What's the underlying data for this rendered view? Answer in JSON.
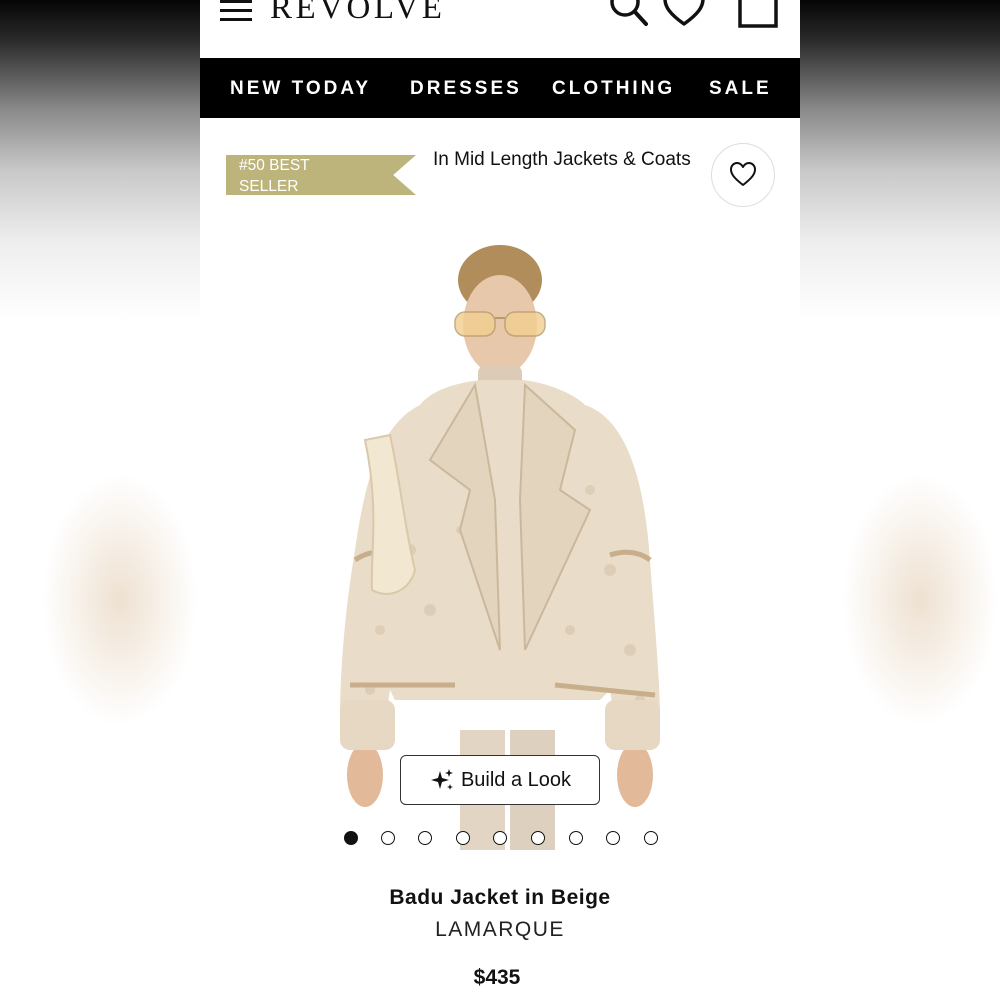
{
  "header": {
    "logo": "REVOLVE",
    "icons": [
      "menu-icon",
      "search-icon",
      "heart-icon",
      "shopping-bag-icon"
    ]
  },
  "nav": {
    "items": [
      "NEW TODAY",
      "DRESSES",
      "CLOTHING",
      "SALE"
    ]
  },
  "badge": {
    "label": "#50 BEST SELLER",
    "color": "#bdb47c"
  },
  "category": {
    "text": "In Mid Length Jackets & Coats"
  },
  "gallery": {
    "build_look_label": "Build a Look",
    "image_count": 9,
    "current_image": 1
  },
  "product": {
    "name": "Badu Jacket in Beige",
    "brand": "LAMARQUE",
    "price": "$435"
  }
}
